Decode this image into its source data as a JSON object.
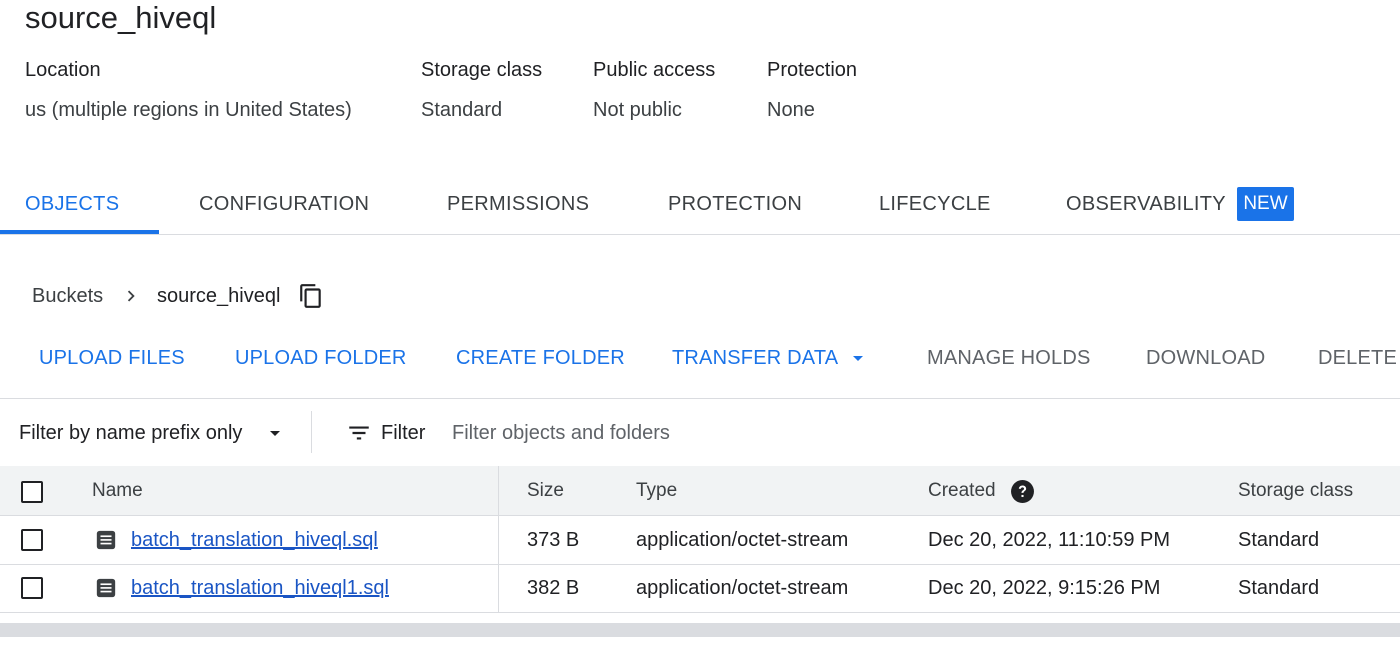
{
  "bucket": {
    "title": "source_hiveql",
    "details": [
      {
        "label": "Location",
        "value": "us (multiple regions in United States)"
      },
      {
        "label": "Storage class",
        "value": "Standard"
      },
      {
        "label": "Public access",
        "value": "Not public"
      },
      {
        "label": "Protection",
        "value": "None"
      }
    ]
  },
  "tabs": [
    {
      "label": "OBJECTS",
      "active": true
    },
    {
      "label": "CONFIGURATION"
    },
    {
      "label": "PERMISSIONS"
    },
    {
      "label": "PROTECTION"
    },
    {
      "label": "LIFECYCLE"
    },
    {
      "label": "OBSERVABILITY",
      "badge": "NEW"
    }
  ],
  "breadcrumb": {
    "root": "Buckets",
    "current": "source_hiveql"
  },
  "actions": {
    "upload_files": "UPLOAD FILES",
    "upload_folder": "UPLOAD FOLDER",
    "create_folder": "CREATE FOLDER",
    "transfer_data": "TRANSFER DATA",
    "manage_holds": "MANAGE HOLDS",
    "download": "DOWNLOAD",
    "delete": "DELETE"
  },
  "filter": {
    "mode": "Filter by name prefix only",
    "button": "Filter",
    "placeholder": "Filter objects and folders"
  },
  "table": {
    "columns": {
      "name": "Name",
      "size": "Size",
      "type": "Type",
      "created": "Created",
      "storage_class": "Storage class"
    },
    "rows": [
      {
        "name": "batch_translation_hiveql.sql",
        "size": "373 B",
        "type": "application/octet-stream",
        "created": "Dec 20, 2022, 11:10:59 PM",
        "storage_class": "Standard"
      },
      {
        "name": "batch_translation_hiveql1.sql",
        "size": "382 B",
        "type": "application/octet-stream",
        "created": "Dec 20, 2022, 9:15:26 PM",
        "storage_class": "Standard"
      }
    ]
  },
  "icons": {
    "breadcrumb_separator": "chevron-right-icon",
    "copy": "copy-icon",
    "dropdown": "arrow-drop-down-icon",
    "filter": "filter-list-icon",
    "help": "help-icon",
    "file": "file-icon"
  },
  "colors": {
    "accent": "#1a73e8",
    "header_bg": "#f1f3f4",
    "border": "#dadce0"
  }
}
